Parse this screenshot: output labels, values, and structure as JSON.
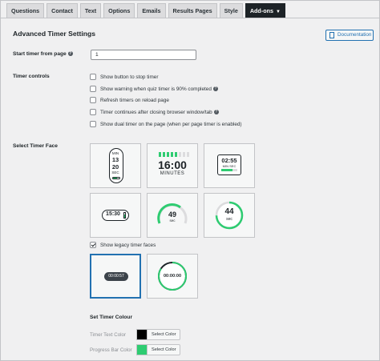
{
  "tabs": [
    {
      "label": "Questions"
    },
    {
      "label": "Contact"
    },
    {
      "label": "Text"
    },
    {
      "label": "Options"
    },
    {
      "label": "Emails"
    },
    {
      "label": "Results Pages"
    },
    {
      "label": "Style"
    },
    {
      "label": "Add-ons",
      "active": true
    }
  ],
  "page": {
    "title": "Advanced Timer Settings",
    "doc_button": "Documentation"
  },
  "start_timer": {
    "label": "Start timer from page",
    "value": "1"
  },
  "timer_controls": {
    "label": "Timer controls",
    "options": [
      {
        "text": "Show button to stop timer",
        "checked": false,
        "help": false
      },
      {
        "text": "Show warning when quiz timer is 90% completed",
        "checked": false,
        "help": true
      },
      {
        "text": "Refresh timers on reload page",
        "checked": false,
        "help": false
      },
      {
        "text": "Timer continues after closing browser window/tab",
        "checked": false,
        "help": true
      },
      {
        "text": "Show dual timer on the page (when per page timer is enabled)",
        "checked": false,
        "help": false
      }
    ]
  },
  "timer_face": {
    "label": "Select Timer Face",
    "face1": {
      "l1": "MIN",
      "l2": "13",
      "l3": "20",
      "l4": "SEC"
    },
    "face2": {
      "time": "16:00",
      "unit": "MINUTES"
    },
    "face3": {
      "time": "02:55",
      "min": "MIN",
      "sec": "SEC"
    },
    "face4": {
      "time": "15:30"
    },
    "face5": {
      "value": "49",
      "unit": "sec",
      "progress": 0.8
    },
    "face6": {
      "value": "44",
      "unit": "sec",
      "progress": 0.75
    },
    "legacy_label": "Show legacy timer faces",
    "legacy_checked": true,
    "legacy1": {
      "time": "00:00:57"
    },
    "legacy2": {
      "time": "00:00:00"
    }
  },
  "timer_colour": {
    "heading": "Set Timer Colour",
    "text_color_label": "Timer Text Color",
    "text_color": "#000000",
    "progress_color_label": "Progress Bar Color",
    "progress_color": "#2ecc71",
    "select_button": "Select Color"
  },
  "colors": {
    "accent": "#2271b1",
    "green": "#2ecc71",
    "dark": "#1d2327"
  }
}
